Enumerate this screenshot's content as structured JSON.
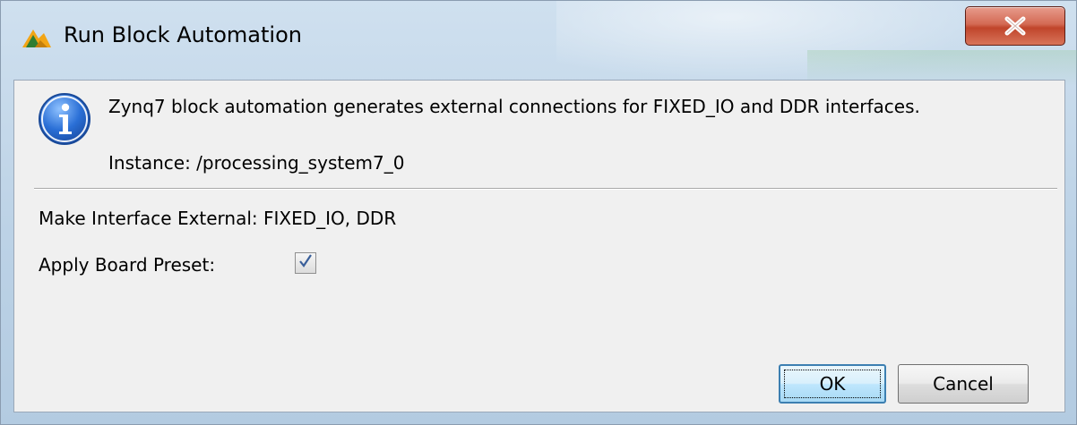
{
  "window": {
    "title": "Run Block Automation",
    "icon": "vivado-logo-icon",
    "close_icon": "close-icon"
  },
  "info": {
    "icon": "info-icon",
    "description": "Zynq7 block automation generates external connections for FIXED_IO and DDR interfaces.",
    "instance": "Instance: /processing_system7_0"
  },
  "options": {
    "make_external_label": "Make Interface External: FIXED_IO, DDR",
    "apply_board_preset_label": "Apply Board Preset:",
    "apply_board_preset_checked": true
  },
  "buttons": {
    "ok_label": "OK",
    "cancel_label": "Cancel"
  },
  "colors": {
    "close_button": "#c0452b",
    "dialog_background": "#f0f0f0",
    "ok_button_border": "#3c7fb1"
  }
}
